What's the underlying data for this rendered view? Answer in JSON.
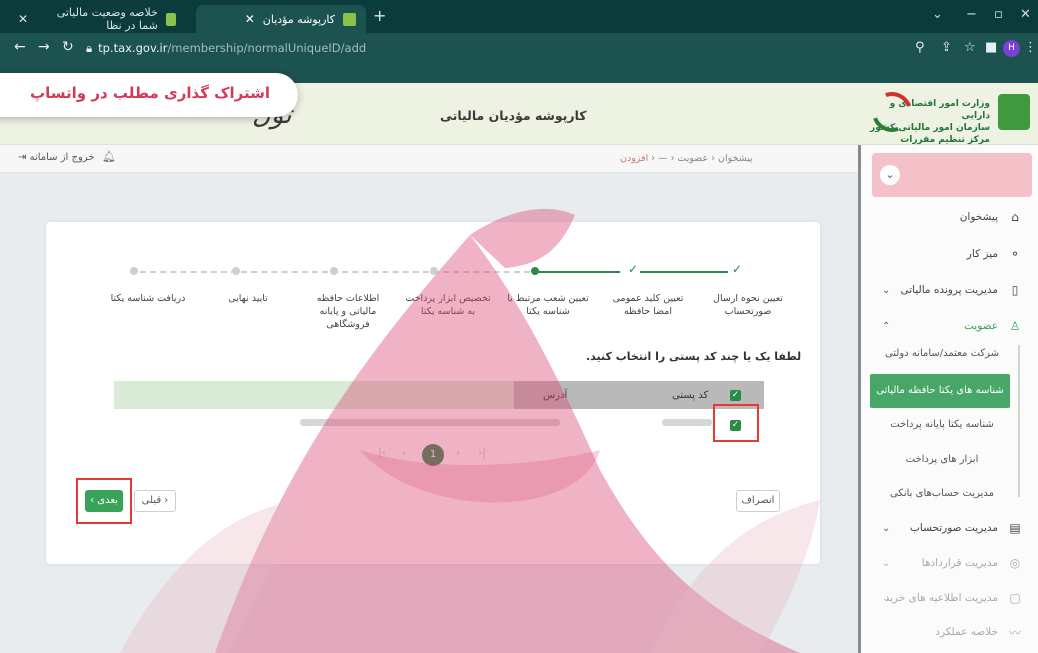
{
  "browser": {
    "tabs": [
      {
        "label": "خلاصه وضعیت مالیاتی شما در نظا",
        "active": false
      },
      {
        "label": "کارپوشه مؤدیان",
        "active": true
      }
    ],
    "url_host": "tp.tax.gov.ir",
    "url_path": "/membership/normalUniqueID/add",
    "profile_initial": "H"
  },
  "header": {
    "app_title": "کارپوشه مؤدیان مالیاتی",
    "org_line1": "وزارت امور اقتصادی و دارایی",
    "org_line2": "سازمان امور مالیاتی کشور",
    "org_line3": "مرکز تنظیم مقررات",
    "overlay_banner": "اشتراک گذاری مطلب در واتساپ",
    "scribble": "تول"
  },
  "subheader": {
    "logout": "خروج از سامانه",
    "breadcrumb": [
      "پیشخوان",
      "عضویت",
      "—",
      "افزودن"
    ]
  },
  "sidebar": {
    "items": [
      {
        "label": "پیشخوان",
        "icon": "home-icon"
      },
      {
        "label": "میز کار",
        "icon": "workflow-icon"
      },
      {
        "label": "مدیریت پرونده مالیاتی",
        "icon": "file-icon"
      },
      {
        "label": "عضویت",
        "icon": "user-icon"
      }
    ],
    "sub_items": [
      "شرکت معتمد/سامانه دولتی",
      "شناسه های یکتا حافظه مالیاتی",
      "شناسه یکتا پایانه پرداخت",
      "ابزار های پرداخت",
      "مدیریت حساب‌های بانکی"
    ],
    "lower_items": [
      "مدیریت صورتحساب",
      "مدیریت قراردادها",
      "مدیریت اطلاعیه های خرید",
      "خلاصه عملکرد"
    ]
  },
  "stepper": {
    "steps": [
      "تعیین نحوه ارسال صورتحساب",
      "تعیین کلید عمومی امضا حافظه",
      "تعیین شعب مرتبط با شناسه یکتا",
      "تخصیص ابزار پرداخت به شناسه یکتا",
      "اطلاعات حافظه مالیاتی و پایانه فروشگاهی",
      "تایید نهایی",
      "دریافت شناسه یکتا"
    ],
    "completed": 2,
    "current": 3
  },
  "form": {
    "prompt": "لطفا یک یا چند کد پستی را انتخاب کنید.",
    "columns": [
      "کد پستی",
      "آدرس"
    ],
    "pages": [
      "1"
    ]
  },
  "buttons": {
    "next": "بعدی",
    "prev": "قبلی",
    "cancel": "انصراف"
  },
  "colors": {
    "accent_green": "#3aa35a",
    "dark_teal": "#0b3b3a",
    "highlight_red": "#e53935",
    "watermark_pink": "#d94b74"
  }
}
